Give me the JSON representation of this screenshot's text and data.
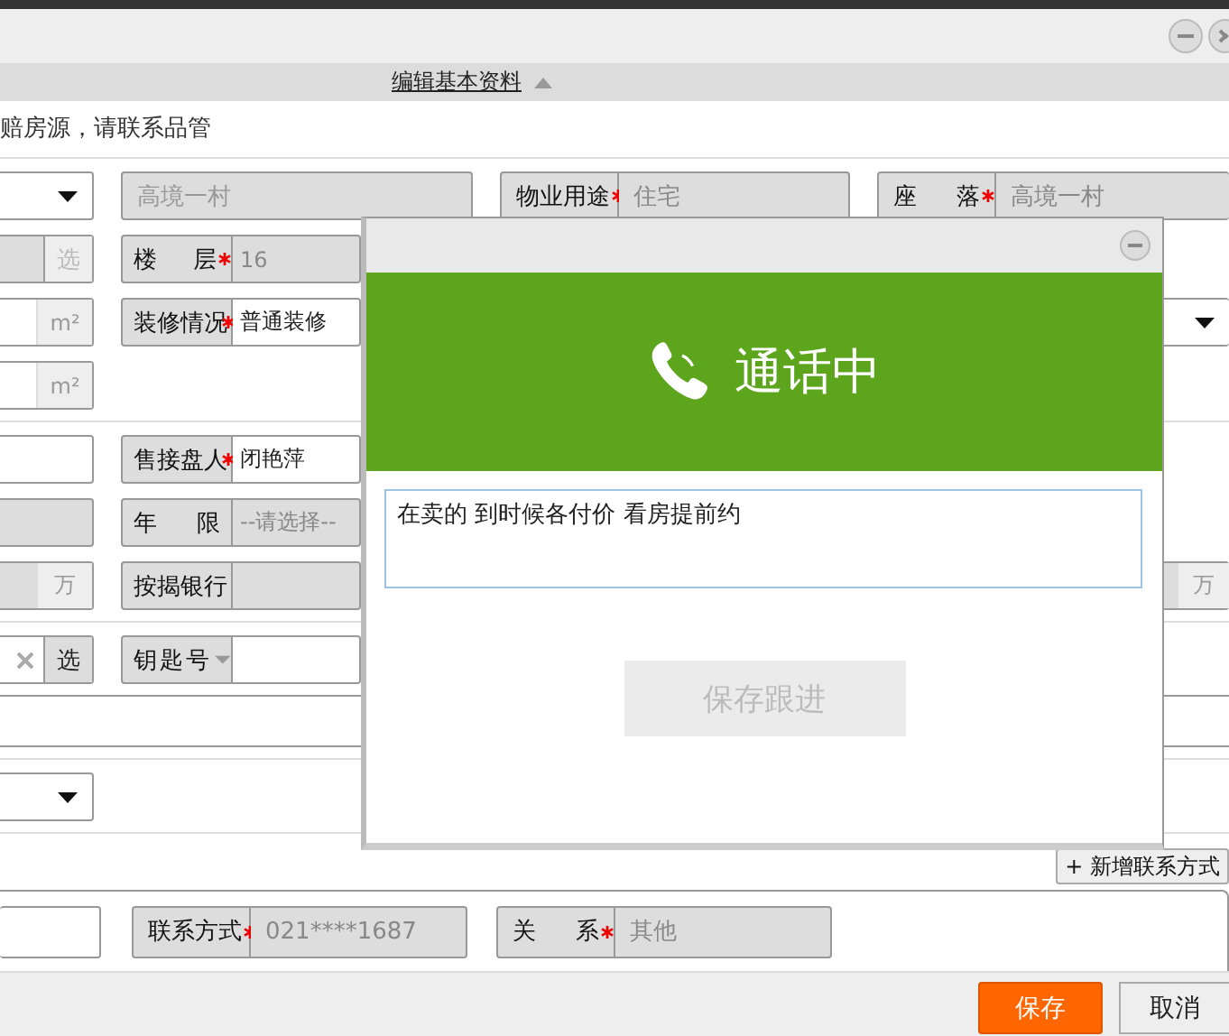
{
  "section_header": {
    "title": "编辑基本资料",
    "expanded": true
  },
  "notice": "赔房源，请联系品管",
  "form": {
    "groups": [
      {
        "rows": [
          {
            "kind": "fields",
            "cells": [
              {
                "kind": "select"
              },
              {
                "kind": "input",
                "value": "高境一村",
                "disabled": true
              },
              {
                "kind": "pair",
                "label": "物业用途",
                "required": true,
                "value": "住宅",
                "disabled": true
              },
              {
                "kind": "pair",
                "label": "座落",
                "required": true,
                "value": "高境一村",
                "disabled": true
              }
            ]
          },
          {
            "kind": "fields",
            "cells": [
              {
                "kind": "input",
                "disabled": true,
                "button": {
                  "label": "选",
                  "disabled": true
                }
              },
              {
                "kind": "pair",
                "label": "楼层",
                "required": true,
                "value": "16",
                "disabled": true
              }
            ]
          },
          {
            "kind": "fields",
            "cells": [
              {
                "kind": "input",
                "disabled": false,
                "unit": "m²"
              },
              {
                "kind": "pair",
                "label": "装修情况",
                "required": true,
                "value": "普通装修",
                "disabled": false
              }
            ],
            "right": [
              {
                "kind": "select"
              }
            ]
          },
          {
            "kind": "fields",
            "cells": [
              {
                "kind": "input",
                "disabled": false,
                "unit": "m²"
              }
            ]
          }
        ]
      },
      {
        "rows": [
          {
            "kind": "fields",
            "cells": [
              {
                "kind": "input",
                "disabled": false
              },
              {
                "kind": "pair",
                "label": "售接盘人",
                "required": true,
                "value": "闭艳萍",
                "disabled": false
              }
            ]
          },
          {
            "kind": "fields",
            "cells": [
              {
                "kind": "input",
                "disabled": true
              },
              {
                "kind": "pair",
                "label": "年限",
                "required": false,
                "value": "--请选择--",
                "disabled": true
              }
            ]
          },
          {
            "kind": "fields",
            "cells": [
              {
                "kind": "input",
                "disabled": true,
                "unit": "万"
              },
              {
                "kind": "pair",
                "label": "按揭银行",
                "required": false,
                "disabled": true
              }
            ],
            "right": [
              {
                "kind": "input",
                "disabled": true,
                "unit": "万"
              }
            ]
          }
        ]
      },
      {
        "rows": [
          {
            "kind": "fields",
            "cells": [
              {
                "kind": "input",
                "disabled": false,
                "clearable": true,
                "button": {
                  "label": "选",
                  "disabled": false
                }
              },
              {
                "kind": "pair",
                "label": "钥匙号",
                "required": false,
                "menu": true,
                "disabled": false
              }
            ]
          },
          {
            "kind": "textarea"
          }
        ]
      },
      {
        "rows": [
          {
            "kind": "fields",
            "cells": [
              {
                "kind": "select"
              }
            ]
          }
        ]
      }
    ]
  },
  "add_contact_button": "+ 新增联系方式",
  "contacts": [
    {
      "cells": [
        {
          "kind": "input",
          "disabled": false
        },
        {
          "kind": "pair",
          "label": "联系方式",
          "required": true,
          "value": "021****1687",
          "disabled": true
        },
        {
          "kind": "pair",
          "label": "关系",
          "required": true,
          "value": "其他",
          "disabled": true
        }
      ]
    }
  ],
  "footer_buttons": [
    {
      "label": "保存",
      "kind": "primary"
    },
    {
      "label": "取消",
      "kind": "default"
    }
  ],
  "call_dialog": {
    "title": "通话中",
    "note": "在卖的 到时候各付价 看房提前约",
    "save_button": {
      "label": "保存跟进",
      "disabled": true
    }
  }
}
